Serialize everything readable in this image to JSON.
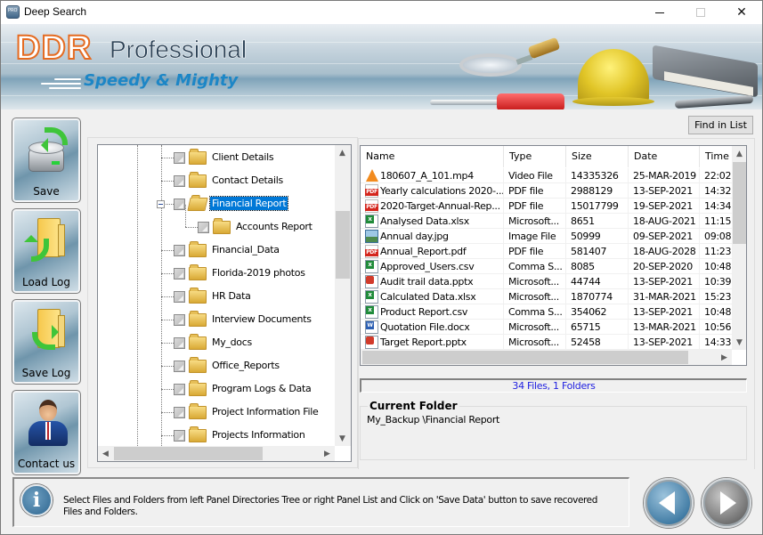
{
  "window": {
    "title": "Deep Search",
    "controls": {
      "minimize": "minimize",
      "maximize": "maximize",
      "close": "✕"
    }
  },
  "banner": {
    "brand": "DDR",
    "product": "Professional",
    "tagline": "Speedy & Mighty"
  },
  "sidebar": {
    "buttons": [
      {
        "label": "Save",
        "icon": "drive-save-icon"
      },
      {
        "label": "Load Log",
        "icon": "folder-load-icon"
      },
      {
        "label": "Save Log",
        "icon": "folder-save-icon"
      },
      {
        "label": "Contact us",
        "icon": "contact-person-icon"
      }
    ]
  },
  "tree": {
    "items": [
      {
        "label": "Client Details",
        "level": 2,
        "expanded": false,
        "selected": false
      },
      {
        "label": "Contact Details",
        "level": 2,
        "expanded": false,
        "selected": false
      },
      {
        "label": "Financial Report",
        "level": 2,
        "expanded": true,
        "selected": true
      },
      {
        "label": "Accounts Report",
        "level": 3,
        "expanded": false,
        "selected": false
      },
      {
        "label": "Financial_Data",
        "level": 2,
        "expanded": false,
        "selected": false
      },
      {
        "label": "Florida-2019 photos",
        "level": 2,
        "expanded": false,
        "selected": false
      },
      {
        "label": "HR Data",
        "level": 2,
        "expanded": false,
        "selected": false
      },
      {
        "label": "Interview Documents",
        "level": 2,
        "expanded": false,
        "selected": false
      },
      {
        "label": "My_docs",
        "level": 2,
        "expanded": false,
        "selected": false
      },
      {
        "label": "Office_Reports",
        "level": 2,
        "expanded": false,
        "selected": false
      },
      {
        "label": "Program Logs & Data",
        "level": 2,
        "expanded": false,
        "selected": false
      },
      {
        "label": "Project Information File",
        "level": 2,
        "expanded": false,
        "selected": false
      },
      {
        "label": "Projects Information",
        "level": 2,
        "expanded": false,
        "selected": false
      }
    ]
  },
  "toolbar": {
    "find_label": "Find in List"
  },
  "file_list": {
    "columns": [
      "Name",
      "Type",
      "Size",
      "Date",
      "Time"
    ],
    "rows": [
      {
        "icon": "vlc",
        "name": "180607_A_101.mp4",
        "type": "Video File",
        "size": "14335326",
        "date": "25-MAR-2019",
        "time": "22:02"
      },
      {
        "icon": "pdf",
        "name": "Yearly calculations 2020-...",
        "type": "PDF file",
        "size": "2988129",
        "date": "13-SEP-2021",
        "time": "14:32"
      },
      {
        "icon": "pdf",
        "name": "2020-Target-Annual-Rep...",
        "type": "PDF file",
        "size": "15017799",
        "date": "19-SEP-2021",
        "time": "14:34"
      },
      {
        "icon": "xls",
        "name": "Analysed Data.xlsx",
        "type": "Microsoft...",
        "size": "8651",
        "date": "18-AUG-2021",
        "time": "11:15"
      },
      {
        "icon": "img",
        "name": "Annual day.jpg",
        "type": "Image File",
        "size": "50999",
        "date": "09-SEP-2021",
        "time": "09:08"
      },
      {
        "icon": "pdf",
        "name": "Annual_Report.pdf",
        "type": "PDF file",
        "size": "581407",
        "date": "18-AUG-2028",
        "time": "11:23"
      },
      {
        "icon": "xls",
        "name": "Approved_Users.csv",
        "type": "Comma S...",
        "size": "8085",
        "date": "20-SEP-2020",
        "time": "10:48"
      },
      {
        "icon": "ppt",
        "name": "Audit trail data.pptx",
        "type": "Microsoft...",
        "size": "44744",
        "date": "13-SEP-2021",
        "time": "10:39"
      },
      {
        "icon": "xls",
        "name": "Calculated Data.xlsx",
        "type": "Microsoft...",
        "size": "1870774",
        "date": "31-MAR-2021",
        "time": "15:23"
      },
      {
        "icon": "xls",
        "name": "Product Report.csv",
        "type": "Comma S...",
        "size": "354062",
        "date": "13-SEP-2021",
        "time": "10:48"
      },
      {
        "icon": "doc",
        "name": "Quotation File.docx",
        "type": "Microsoft...",
        "size": "65715",
        "date": "13-MAR-2021",
        "time": "10:56"
      },
      {
        "icon": "ppt",
        "name": "Target Report.pptx",
        "type": "Microsoft...",
        "size": "52458",
        "date": "13-SEP-2021",
        "time": "14:33"
      }
    ]
  },
  "status": {
    "summary": "34 Files, 1 Folders"
  },
  "current_folder": {
    "title": "Current Folder",
    "path": "My_Backup \\Financial Report"
  },
  "info": {
    "message": "Select Files and Folders from left Panel Directories Tree or right Panel List and Click on 'Save Data' button to save recovered Files and Folders."
  },
  "nav": {
    "back": "back",
    "next": "next"
  },
  "colors": {
    "selection": "#0078d7",
    "status_text": "#2020e0",
    "brand_orange": "#e56b21",
    "tagline_blue": "#1c86c6"
  }
}
